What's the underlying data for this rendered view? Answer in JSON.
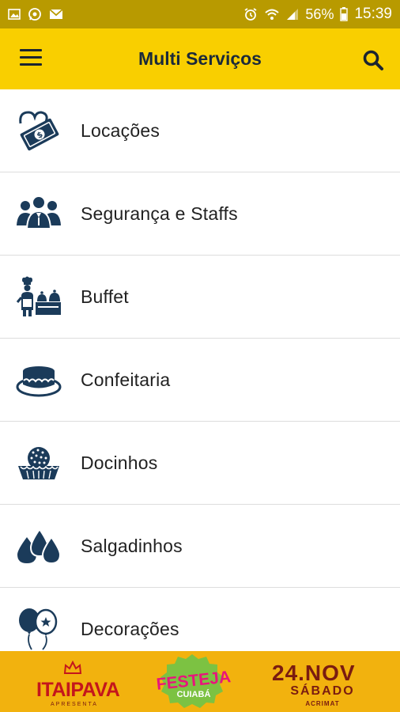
{
  "status_bar": {
    "battery_percent": "56%",
    "time": "15:39",
    "icons": [
      "image-icon",
      "whatsapp-icon",
      "gmail-icon",
      "alarm-icon",
      "wifi-icon",
      "signal-icon",
      "battery-icon"
    ]
  },
  "app_bar": {
    "title": "Multi Serviços",
    "menu_icon": "hamburger-menu-icon",
    "search_icon": "search-icon",
    "background": "#f9cf00"
  },
  "categories": [
    {
      "label": "Locações",
      "icon": "money-hand-icon"
    },
    {
      "label": "Segurança e Staffs",
      "icon": "staff-group-icon"
    },
    {
      "label": "Buffet",
      "icon": "chef-buffet-icon"
    },
    {
      "label": "Confeitaria",
      "icon": "cake-icon"
    },
    {
      "label": "Docinhos",
      "icon": "sweet-cupcake-icon"
    },
    {
      "label": "Salgadinhos",
      "icon": "drops-icon"
    },
    {
      "label": "Decorações",
      "icon": "balloons-icon"
    }
  ],
  "banner": {
    "brand": "ITAIPAVA",
    "brand_subtitle": "APRESENTA",
    "event_name": "FESTEJA",
    "event_city": "CUIABÁ",
    "date": "24.NOV",
    "weekday": "SÁBADO",
    "venue": "ACRIMAT"
  }
}
